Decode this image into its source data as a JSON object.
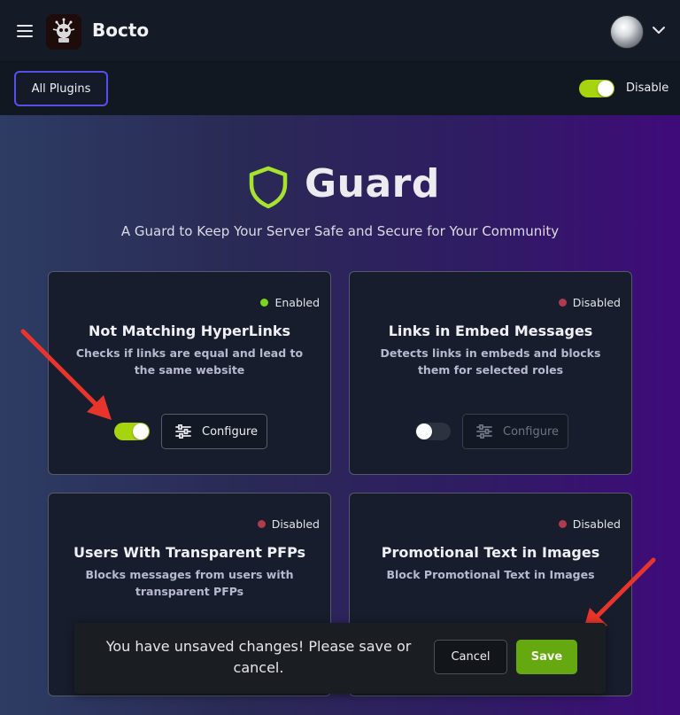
{
  "app": {
    "title": "Bocto"
  },
  "header": {
    "menu_icon": "hamburger-icon",
    "logo_icon": "bot-logo",
    "account_icon": "chevron-down-icon"
  },
  "toolbar": {
    "all_plugins_label": "All Plugins",
    "global_toggle_on": true,
    "global_toggle_label": "Disable"
  },
  "plugin": {
    "title": "Guard",
    "subtitle": "A Guard to Keep Your Server Safe and Secure for Your Community",
    "icon": "shield-icon",
    "accent_color": "#a6e22e"
  },
  "cards": [
    {
      "status": "Enabled",
      "status_color": "#7ed321",
      "title": "Not Matching HyperLinks",
      "description": "Checks if links are equal and lead to the same website",
      "enabled": true,
      "configure_label": "Configure"
    },
    {
      "status": "Disabled",
      "status_color": "#b03a4e",
      "title": "Links in Embed Messages",
      "description": "Detects links in embeds and blocks them for selected roles",
      "enabled": false,
      "configure_label": "Configure"
    },
    {
      "status": "Disabled",
      "status_color": "#b03a4e",
      "title": "Users With Transparent PFPs",
      "description": "Blocks messages from users with transparent PFPs"
    },
    {
      "status": "Disabled",
      "status_color": "#b03a4e",
      "title": "Promotional Text in Images",
      "description": "Block Promotional Text in Images"
    }
  ],
  "unsaved_bar": {
    "message": "You have unsaved changes! Please save or cancel.",
    "cancel_label": "Cancel",
    "save_label": "Save",
    "save_color": "#66a80f"
  },
  "colors": {
    "toggle_on": "#a6d40f",
    "primary_border": "#5750e6",
    "annotation_arrow": "#e8352b"
  }
}
